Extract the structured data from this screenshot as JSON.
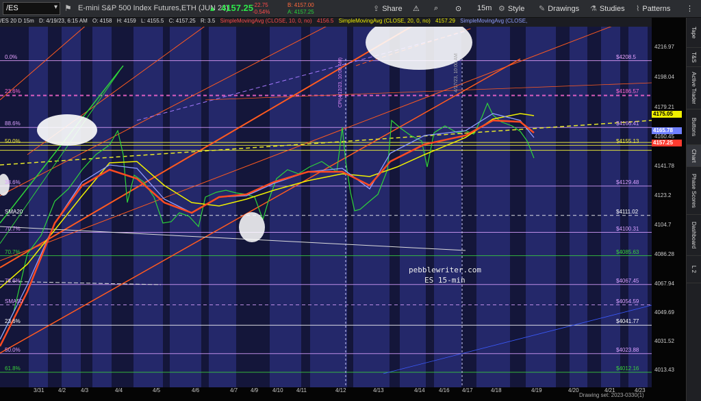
{
  "toolbar": {
    "symbol": "/ES",
    "instrument": "E-mini S&P 500 Index Futures,ETH (JUN 23)",
    "last": "4157.25",
    "change": "-22.75",
    "change_pct": "-0.54%",
    "bid": "B: 4157.00",
    "ask": "A: 4157.25",
    "share": "Share",
    "interval": "15m",
    "style": "Style",
    "drawings": "Drawings",
    "studies": "Studies",
    "patterns": "Patterns",
    "colors": {
      "up": "#2ee64a",
      "down": "#ff4b4b",
      "accent": "#1e6fff"
    }
  },
  "infobar": {
    "desc": "/ES 20 D 15m",
    "date": "D: 4/19/23, 6:15 AM",
    "open": "O: 4158",
    "high": "H: 4159",
    "low": "L: 4155.5",
    "close": "C: 4157.25",
    "range": "R: 3.5",
    "sma10": "SimpleMovingAvg (CLOSE, 10, 0, no)",
    "sma10_val": "4156.5",
    "sma20": "SimpleMovingAvg (CLOSE, 20, 0, no)",
    "sma20_val": "4157.29",
    "sma30": "SimpleMovingAvg (CLOSE,"
  },
  "price_axis": {
    "ticks": [
      "4216.97",
      "4198.04",
      "4179.21",
      "4160.45",
      "4141.78",
      "4123.2",
      "4104.7",
      "4086.28",
      "4067.94",
      "4049.69",
      "4031.52",
      "4013.43"
    ],
    "badges": [
      {
        "value": "4175.05",
        "bg": "#f0f000",
        "fg": "#000"
      },
      {
        "value": "4165.78",
        "bg": "#6f7fff",
        "fg": "#fff"
      },
      {
        "value": "4157.25",
        "bg": "#ff3b2f",
        "fg": "#fff"
      }
    ]
  },
  "time_axis": {
    "ticks": [
      "3/31",
      "4/2",
      "4/3",
      "4/4",
      "4/5",
      "4/6",
      "4/7",
      "4/9",
      "4/10",
      "4/11",
      "4/12",
      "4/13",
      "4/14",
      "4/16",
      "4/17",
      "4/18",
      "4/19",
      "4/20",
      "4/21",
      "4/23"
    ]
  },
  "levels": [
    {
      "left": "0.0%",
      "right": "$4208.5",
      "color": "#e7a3ff"
    },
    {
      "left": "23.6%",
      "right": "$4186.57",
      "color": "#ff69d2"
    },
    {
      "left": "88.6%",
      "right": "$4166.41",
      "color": "#d9a0ff"
    },
    {
      "left": "50.0%",
      "right": "$4155.13",
      "color": "#f5ef3c"
    },
    {
      "left": "38.6%",
      "right": "$4129.48",
      "color": "#d9a0ff"
    },
    {
      "left": "SMA20",
      "right": "$4111.02",
      "color": "#ffffff"
    },
    {
      "left": "70.7%",
      "right": "$4100.31",
      "color": "#d9a0ff"
    },
    {
      "left": "70.7%",
      "right": "$4085.63",
      "color": "#39d33c"
    },
    {
      "left": "78.6%",
      "right": "$4067.45",
      "color": "#d9a0ff"
    },
    {
      "left": "SMA50",
      "right": "$4054.59",
      "color": "#d9a0ff"
    },
    {
      "left": "23.6%",
      "right": "$4041.77",
      "color": "#ffffff"
    },
    {
      "left": "50.0%",
      "right": "$4023.88",
      "color": "#d9a0ff"
    },
    {
      "left": "61.8%",
      "right": "$4012.16",
      "color": "#39d33c"
    }
  ],
  "annotations": {
    "site": "pebblewriter.com",
    "subtitle": "ES 15-min",
    "cpi": "CPI(4/12/23, 10:00 AM)",
    "label_4_17": "4/17/23, 10:00 AM"
  },
  "sidebar": [
    "Tape",
    "T&S",
    "Active Trader",
    "Buttons",
    "Chart",
    "Phase Scores",
    "Dashboard",
    "L 2"
  ],
  "status": {
    "drawing_set": "Drawing set: 2023-0330(1)"
  }
}
